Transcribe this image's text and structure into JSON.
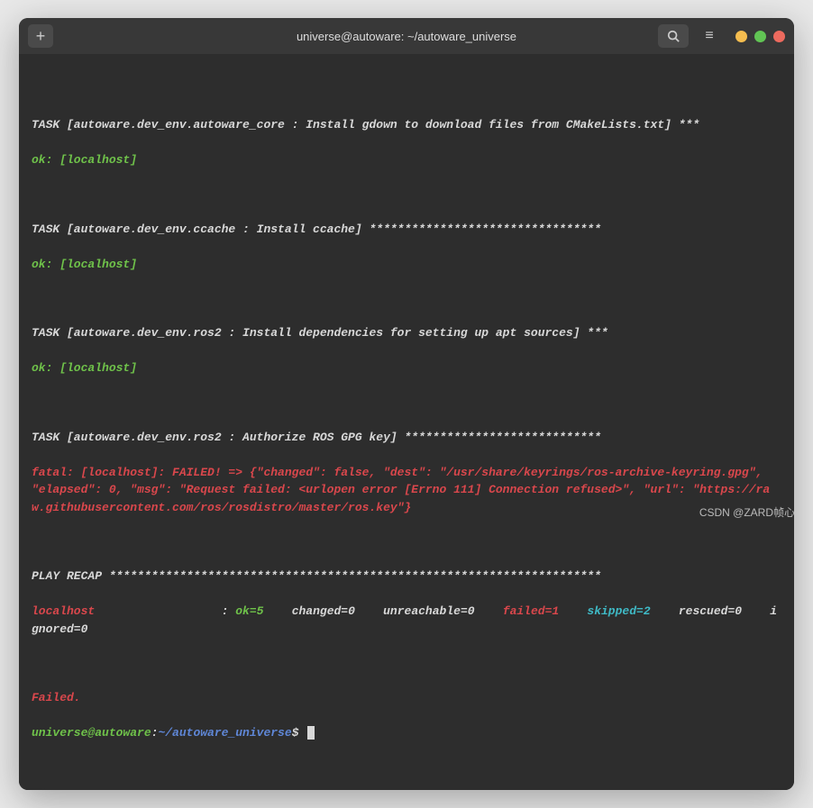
{
  "window": {
    "title": "universe@autoware: ~/autoware_universe"
  },
  "tasks": {
    "t1": {
      "header": "TASK [autoware.dev_env.autoware_core : Install gdown to download files from CMakeLists.txt] ***",
      "status": "ok: [localhost]"
    },
    "t2": {
      "header": "TASK [autoware.dev_env.ccache : Install ccache] *********************************",
      "status": "ok: [localhost]"
    },
    "t3": {
      "header": "TASK [autoware.dev_env.ros2 : Install dependencies for setting up apt sources] ***",
      "status": "ok: [localhost]"
    },
    "t4": {
      "header": "TASK [autoware.dev_env.ros2 : Authorize ROS GPG key] ****************************",
      "error": "fatal: [localhost]: FAILED! => {\"changed\": false, \"dest\": \"/usr/share/keyrings/ros-archive-keyring.gpg\", \"elapsed\": 0, \"msg\": \"Request failed: <urlopen error [Errno 111] Connection refused>\", \"url\": \"https://raw.githubusercontent.com/ros/rosdistro/master/ros.key\"}"
    }
  },
  "recap": {
    "header": "PLAY RECAP **********************************************************************",
    "host": "localhost",
    "sep": "                  : ",
    "ok": "ok=5",
    "changed": "changed=0",
    "unreachable": "unreachable=0",
    "failed": "failed=1",
    "skipped": "skipped=2",
    "rescued": "rescued=0",
    "ignored": "ignored=0"
  },
  "footer": {
    "failed": "Failed."
  },
  "prompt": {
    "user_host": "universe@autoware",
    "colon": ":",
    "path": "~/autoware_universe",
    "dollar": "$ "
  },
  "watermark": "CSDN @ZARD帧心"
}
